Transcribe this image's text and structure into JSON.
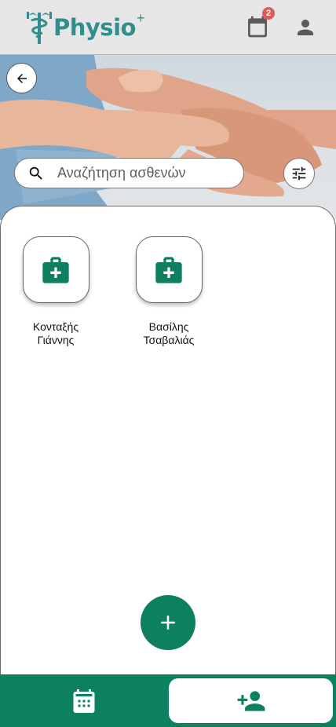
{
  "app": {
    "name": "Physio",
    "name_suffix": "+"
  },
  "header": {
    "calendar_badge_count": "2",
    "icons": [
      "caduceus-logo-icon",
      "calendar-icon",
      "account-icon"
    ]
  },
  "search": {
    "placeholder": "Αναζήτηση ασθενών",
    "value": ""
  },
  "patients": [
    {
      "first_line": "Κονταξής",
      "second_line": "Γιάννης",
      "icon": "medical-kit-icon"
    },
    {
      "first_line": "Βασίλης",
      "second_line": "Τσαβαλιάς",
      "icon": "medical-kit-icon"
    }
  ],
  "colors": {
    "primary": "#0d8060",
    "logo": "#2f8f8c",
    "badge": "#e05a5a",
    "header_bg": "#e6e6e6"
  },
  "bottom_nav": {
    "items": [
      "calendar-icon",
      "add-person-icon"
    ],
    "active": "add-person-icon"
  }
}
